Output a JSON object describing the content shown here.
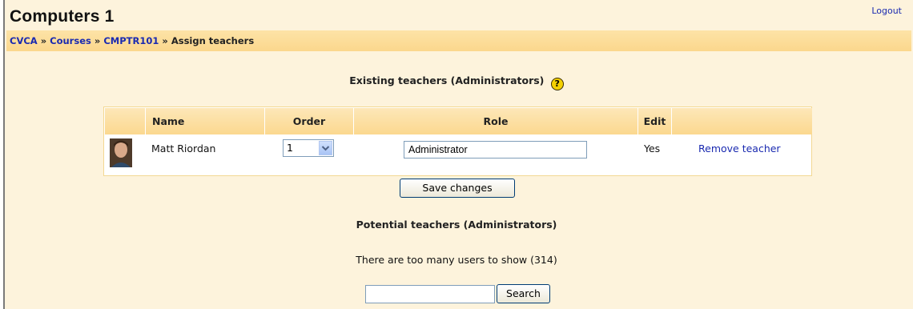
{
  "header": {
    "site_title": "Computers 1",
    "logout_label": "Logout"
  },
  "breadcrumb": {
    "items": [
      "CVCA",
      "Courses",
      "CMPTR101"
    ],
    "current": "Assign teachers",
    "separator": "»"
  },
  "existing": {
    "heading": "Existing teachers (Administrators)",
    "help_icon": "help-icon",
    "columns": {
      "name": "Name",
      "order": "Order",
      "role": "Role",
      "edit": "Edit"
    },
    "rows": [
      {
        "name": "Matt Riordan",
        "order": "1",
        "role": "Administrator",
        "edit": "Yes",
        "action": "Remove teacher"
      }
    ],
    "save_label": "Save changes"
  },
  "potential": {
    "heading": "Potential teachers (Administrators)",
    "message": "There are too many users to show (314)",
    "search_value": "",
    "search_label": "Search"
  },
  "colors": {
    "background": "#fdf3dc",
    "navbar": "#fbd78d",
    "link": "#1a2ab0",
    "table_header": "#fbd88f"
  }
}
